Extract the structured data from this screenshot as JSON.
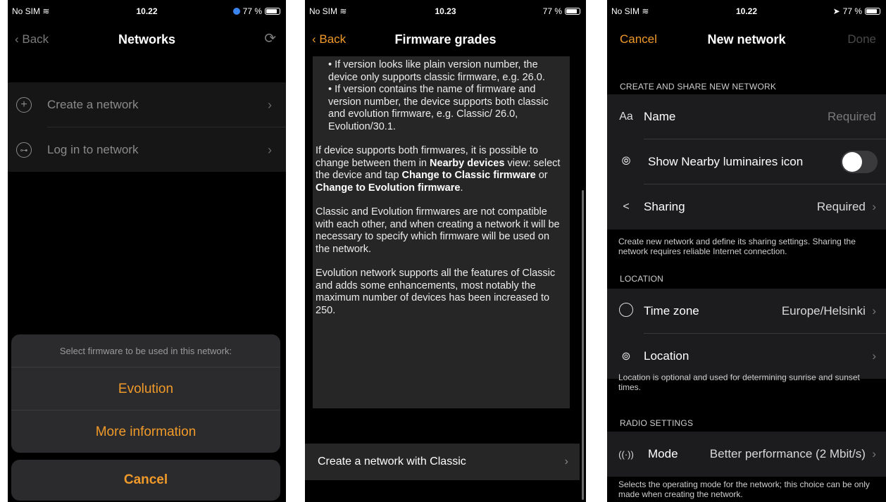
{
  "screen1": {
    "status": {
      "carrier": "No SIM",
      "time": "10.22",
      "battery": "77 %"
    },
    "nav": {
      "back": "Back",
      "title": "Networks"
    },
    "rows": [
      {
        "label": "Create a network",
        "icon": "plus-circle-icon"
      },
      {
        "label": "Log in to network",
        "icon": "key-icon"
      }
    ],
    "sheet": {
      "message": "Select firmware to be used in this network:",
      "actions": [
        "Evolution",
        "More information"
      ],
      "cancel": "Cancel"
    }
  },
  "screen2": {
    "status": {
      "carrier": "No SIM",
      "time": "10.23",
      "battery": "77 %"
    },
    "nav": {
      "back": "Back",
      "title": "Firmware grades"
    },
    "bullet1": "• If version looks like plain version number, the device only supports classic firmware, e.g. 26.0.",
    "bullet2": "• If version contains the name of firmware and version number, the device supports both classic and evolution firmware, e.g. Classic/ 26.0, Evolution/30.1.",
    "para1": {
      "t1": "If device supports both firmwares, it is possible to change between them in ",
      "b1": "Nearby devices",
      "t2": " view: select the device and tap ",
      "b2": "Change to Classic firmware",
      "t3": " or ",
      "b3": "Change to Evolution firmware",
      "t4": "."
    },
    "para2": "Classic and Evolution firmwares are not compatible with each other, and when creating a network it will be necessary to specify which firmware will be used on the network.",
    "para3": "Evolution network supports all the features of Classic and adds some enhancements, most notably the maximum number of devices has been increased to 250.",
    "bottom_row": "Create a network with Classic"
  },
  "screen3": {
    "status": {
      "carrier": "No SIM",
      "time": "10.22",
      "battery": "77 %"
    },
    "nav": {
      "cancel": "Cancel",
      "title": "New network",
      "done": "Done"
    },
    "section1": {
      "header": "CREATE AND SHARE NEW NETWORK",
      "name_icon": "Aa",
      "name_label": "Name",
      "name_placeholder": "Required",
      "nearby_label": "Show Nearby luminaires icon",
      "sharing_label": "Sharing",
      "sharing_value": "Required",
      "footer": "Create new network and define its sharing settings. Sharing the network requires reliable Internet connection."
    },
    "section2": {
      "header": "LOCATION",
      "tz_label": "Time zone",
      "tz_value": "Europe/Helsinki",
      "loc_label": "Location",
      "footer": "Location is optional and used for determining sunrise and sunset times."
    },
    "section3": {
      "header": "RADIO SETTINGS",
      "mode_label": "Mode",
      "mode_value": "Better performance (2 Mbit/s)",
      "footer": "Selects the operating mode for the network; this choice can be only made when creating the network."
    }
  }
}
